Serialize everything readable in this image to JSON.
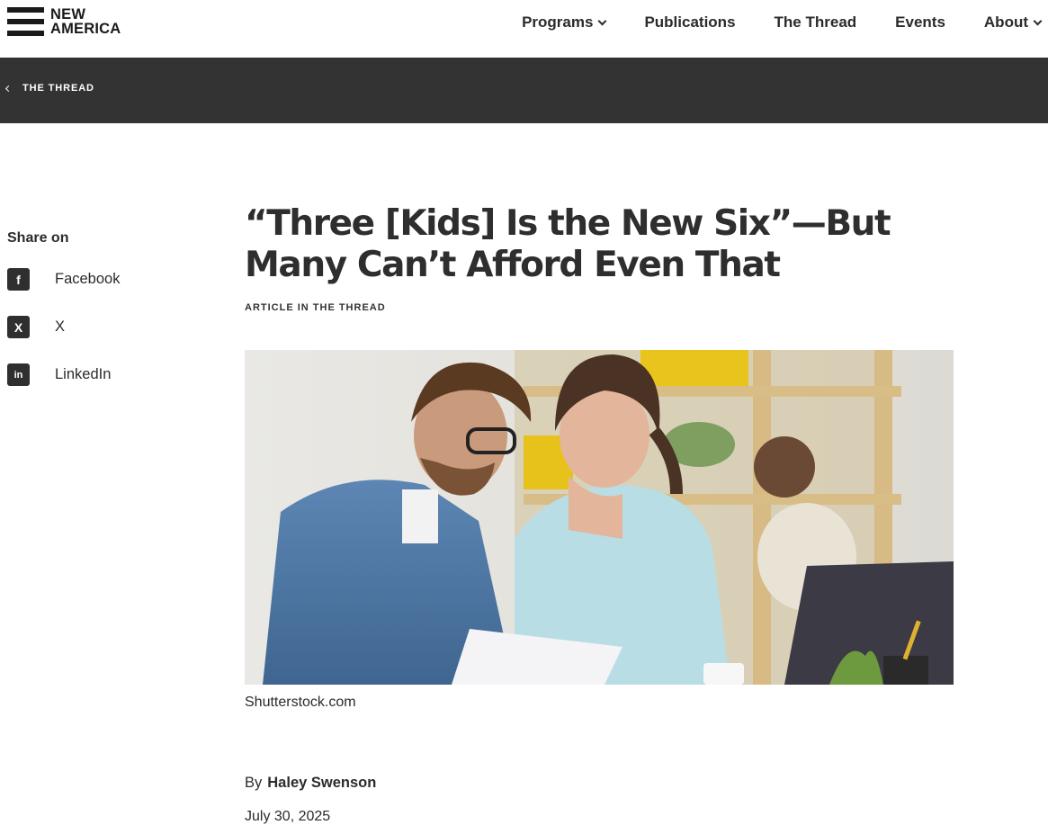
{
  "header": {
    "logo_line1": "NEW",
    "logo_line2": "AMERICA",
    "nav": [
      {
        "label": "Programs",
        "dropdown": true
      },
      {
        "label": "Publications",
        "dropdown": false
      },
      {
        "label": "The Thread",
        "dropdown": false
      },
      {
        "label": "Events",
        "dropdown": false
      },
      {
        "label": "About",
        "dropdown": true
      }
    ]
  },
  "breadcrumb": {
    "label": "THE THREAD",
    "icon": "chevron-left-icon"
  },
  "share": {
    "title": "Share on",
    "items": [
      {
        "label": "Facebook",
        "icon": "facebook-icon",
        "glyph": "f"
      },
      {
        "label": "X",
        "icon": "x-icon",
        "glyph": "X"
      },
      {
        "label": "LinkedIn",
        "icon": "linkedin-icon",
        "glyph": "in"
      }
    ]
  },
  "article": {
    "title": "“Three [Kids] Is the New Six”—But Many Can’t Afford Even That",
    "kicker": "ARTICLE IN THE THREAD",
    "image_caption": "Shutterstock.com",
    "by_prefix": "By",
    "author": "Haley Swenson",
    "date": "July 30, 2025"
  },
  "colors": {
    "band": "#333333",
    "text": "#2b2b2b",
    "icon_bg": "#2f2f2f"
  }
}
